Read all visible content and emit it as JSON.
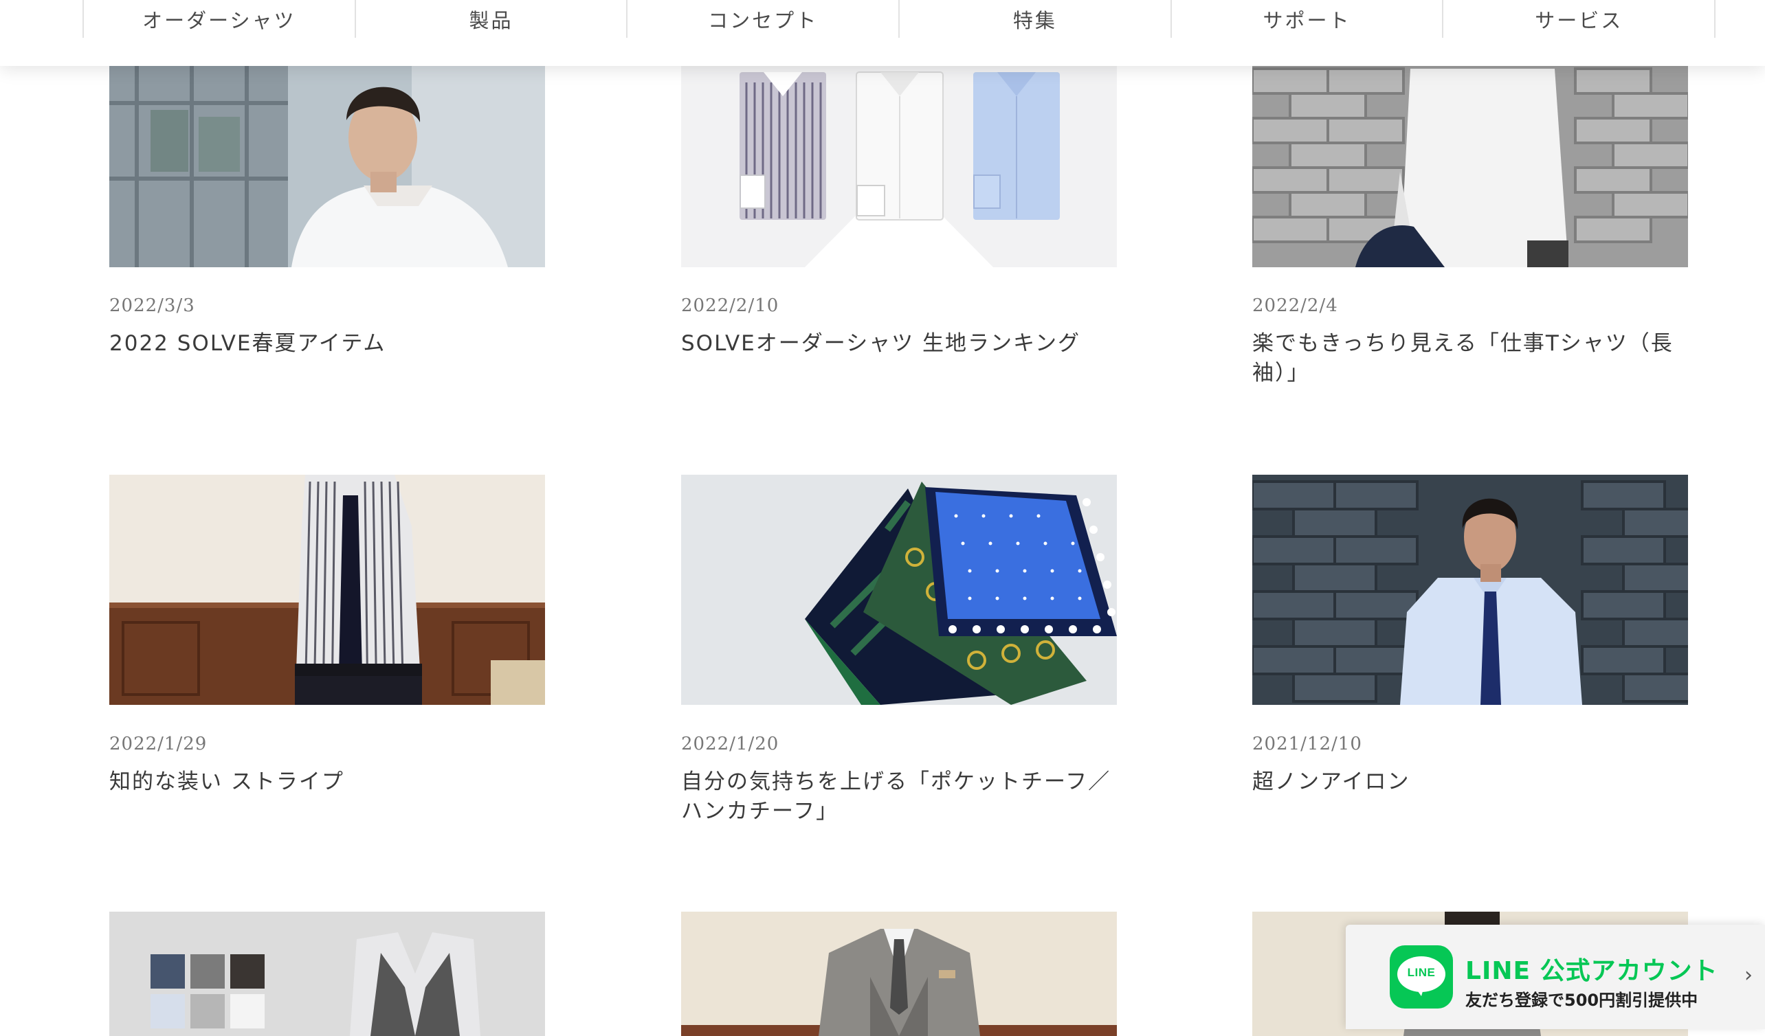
{
  "nav": {
    "items": [
      {
        "label": "オーダーシャツ"
      },
      {
        "label": "製品"
      },
      {
        "label": "コンセプト"
      },
      {
        "label": "特集"
      },
      {
        "label": "サポート"
      },
      {
        "label": "サービス"
      }
    ]
  },
  "articles": [
    {
      "date": "2022/3/3",
      "title": "2022 SOLVE春夏アイテム"
    },
    {
      "date": "2022/2/10",
      "title": "SOLVEオーダーシャツ 生地ランキング"
    },
    {
      "date": "2022/2/4",
      "title": "楽でもきっちり見える「仕事Tシャツ（長袖）」"
    },
    {
      "date": "2022/1/29",
      "title": "知的な装い ストライプ"
    },
    {
      "date": "2022/1/20",
      "title": "自分の気持ちを上げる「ポケットチーフ／ハンカチーフ」"
    },
    {
      "date": "2021/12/10",
      "title": "超ノンアイロン"
    }
  ],
  "line_banner": {
    "logo_text": "LINE",
    "title": "LINE 公式アカウント",
    "subtitle": "友だち登録で500円割引提供中",
    "accent_color": "#06c755"
  }
}
